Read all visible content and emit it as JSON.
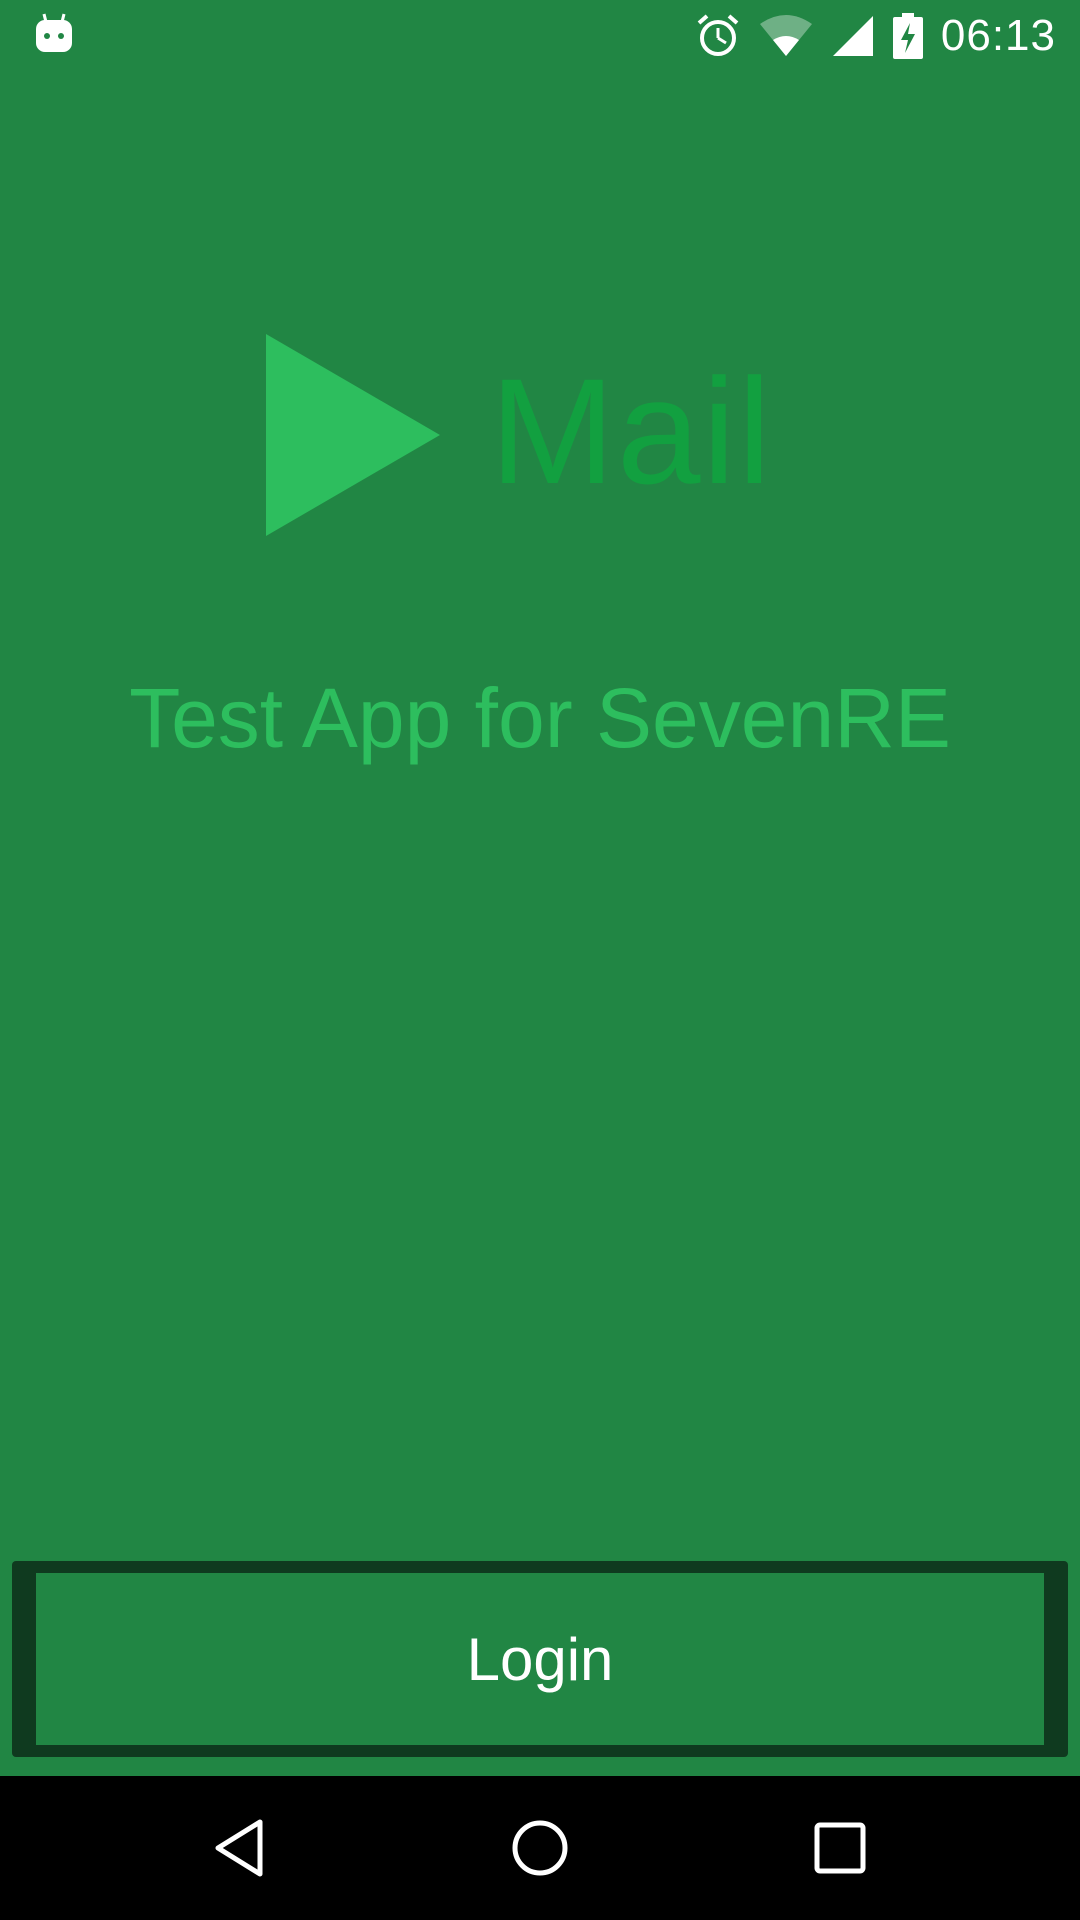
{
  "status_bar": {
    "time": "06:13",
    "icons": [
      "android-notification-icon",
      "alarm-icon",
      "wifi-icon",
      "cellular-signal-icon",
      "battery-charging-icon"
    ]
  },
  "logo": {
    "icon": "play-triangle-icon",
    "text": "Mail"
  },
  "subtitle": "Test App for SevenRE",
  "login_button": {
    "label": "Login"
  },
  "nav_bar": {
    "buttons": [
      "back-icon",
      "home-icon",
      "recents-icon"
    ]
  },
  "colors": {
    "background": "#218644",
    "logo_triangle": "#2dbe5e",
    "logo_text": "#12a040",
    "subtitle": "#2dbe5e",
    "button_border": "#0f3a1f",
    "nav_bar": "#000000"
  }
}
